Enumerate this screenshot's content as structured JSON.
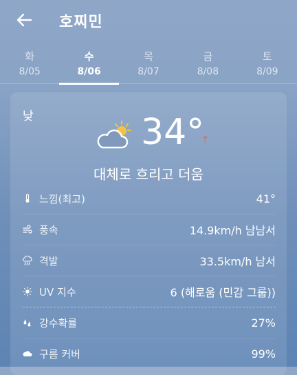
{
  "header": {
    "title": "호찌민"
  },
  "days": [
    {
      "name": "화",
      "date": "8/05"
    },
    {
      "name": "수",
      "date": "8/06"
    },
    {
      "name": "목",
      "date": "8/07"
    },
    {
      "name": "금",
      "date": "8/08"
    },
    {
      "name": "토",
      "date": "8/09"
    }
  ],
  "forecast": {
    "period": "낮",
    "icon": "partly-cloudy-sun-icon",
    "temperature": "34°",
    "trend_arrow": "↑",
    "description": "대체로 흐리고 더움"
  },
  "details": [
    {
      "icon": "thermometer-icon",
      "label": "느낌(최고)",
      "value": "41°"
    },
    {
      "icon": "wind-icon",
      "label": "풍속",
      "value": "14.9km/h 남남서"
    },
    {
      "icon": "gust-icon",
      "label": "격발",
      "value": "33.5km/h 남서"
    },
    {
      "icon": "sun-uv-icon",
      "label": "UV 지수",
      "value": "6 (해로움 (민감 그룹))"
    },
    {
      "icon": "rain-drops-icon",
      "label": "강수확률",
      "value": "27%"
    },
    {
      "icon": "cloud-icon",
      "label": "구름 커버",
      "value": "99%"
    }
  ],
  "colors": {
    "trend_arrow": "#e86a5a",
    "sun": "#f3c443"
  }
}
